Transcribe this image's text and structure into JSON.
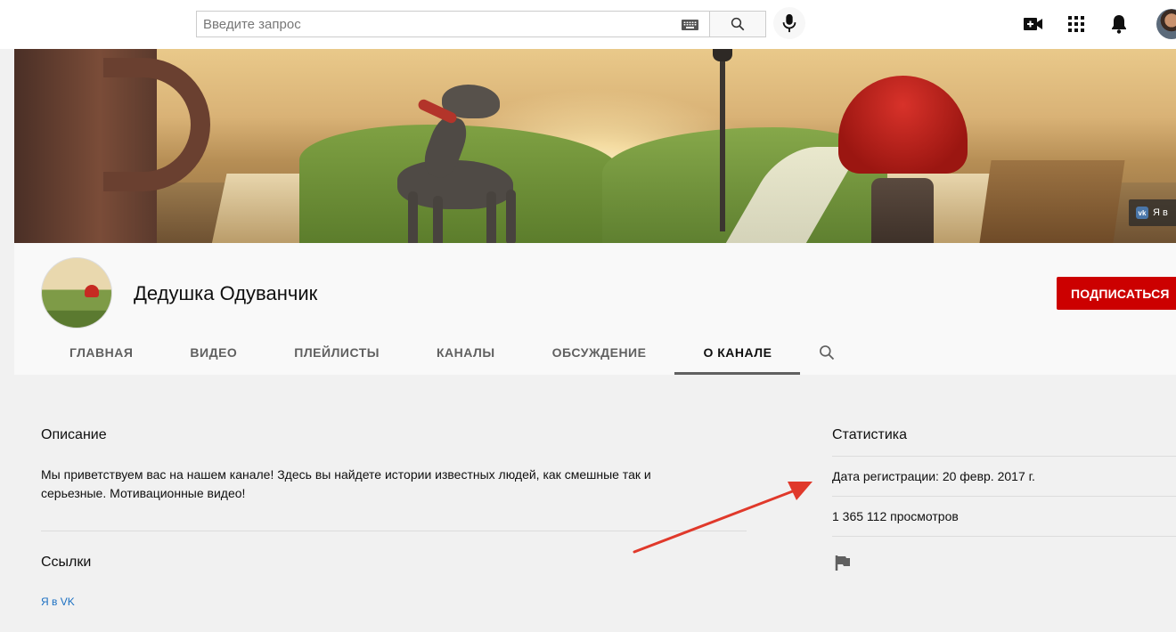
{
  "search": {
    "placeholder": "Введите запрос",
    "value": ""
  },
  "topbar_icons": [
    "keyboard-icon",
    "search-icon",
    "mic-icon",
    "video-camera-icon",
    "apps-icon",
    "bell-icon",
    "avatar"
  ],
  "banner": {
    "vk_link_label": "Я в"
  },
  "channel": {
    "name": "Дедушка Одуванчик",
    "subscribe_label": "ПОДПИСАТЬСЯ",
    "tabs": [
      {
        "label": "ГЛАВНАЯ",
        "active": false
      },
      {
        "label": "ВИДЕО",
        "active": false
      },
      {
        "label": "ПЛЕЙЛИСТЫ",
        "active": false
      },
      {
        "label": "КАНАЛЫ",
        "active": false
      },
      {
        "label": "ОБСУЖДЕНИЕ",
        "active": false
      },
      {
        "label": "О КАНАЛЕ",
        "active": true
      }
    ]
  },
  "about": {
    "description_heading": "Описание",
    "description_line1": "Мы приветствуем вас на нашем канале! Здесь вы найдете истории известных людей, как смешные так и",
    "description_line2": "серьезные. Мотивационные видео!",
    "links_heading": "Ссылки",
    "links": [
      {
        "label": "Я в VK"
      }
    ],
    "stats_heading": "Статистика",
    "registration": "Дата регистрации: 20 февр. 2017 г.",
    "views": "1 365 112 просмотров"
  },
  "colors": {
    "accent": "#cc0000",
    "link": "#1a6fc2",
    "annotation_arrow": "#e0392b"
  }
}
